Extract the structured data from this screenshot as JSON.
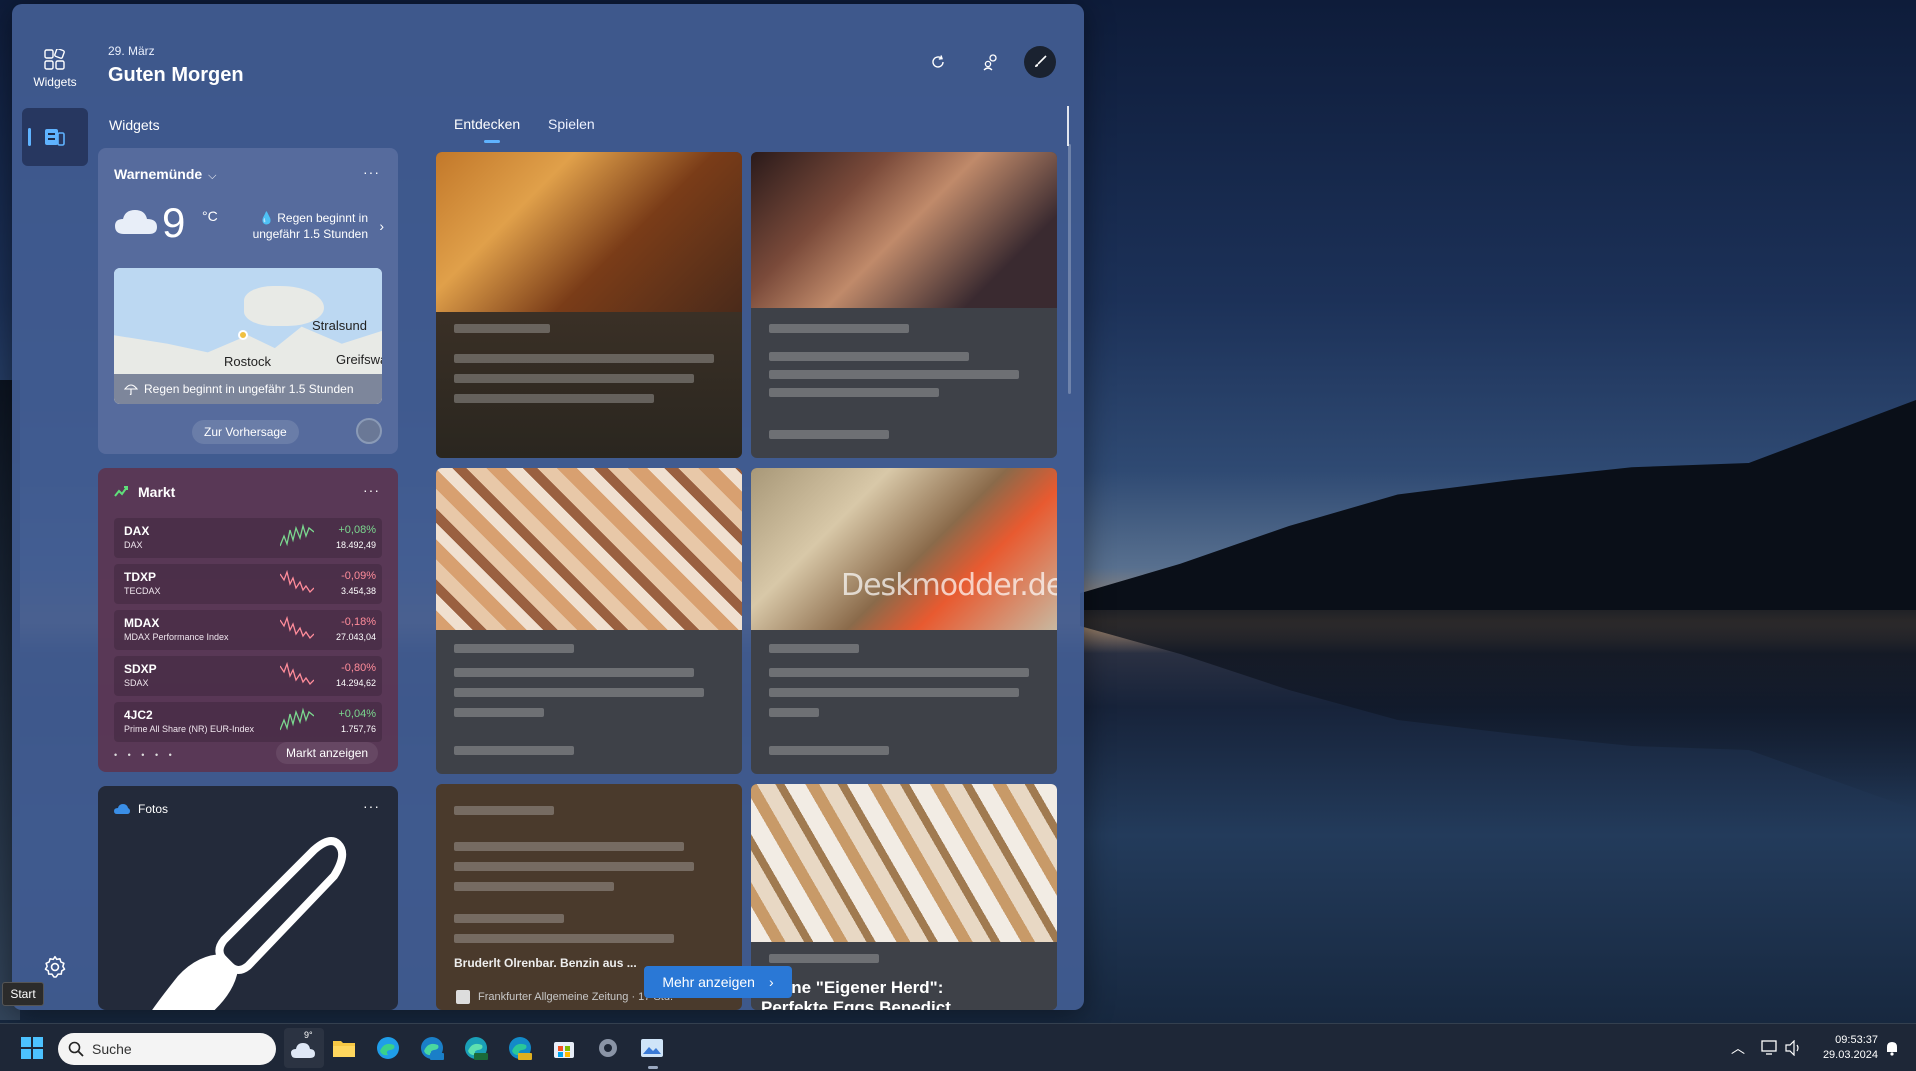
{
  "board": {
    "date": "29. März",
    "greeting": "Guten Morgen",
    "section_label": "Widgets",
    "tabs": [
      "Entdecken",
      "Spielen"
    ]
  },
  "rail": {
    "widgets_label": "Widgets"
  },
  "weather": {
    "location": "Warnemünde",
    "temperature": "9",
    "unit": "°C",
    "rain_notice": "Regen beginnt in ungefähr 1.5 Stunden",
    "map_cities": [
      "Stralsund",
      "Rostock",
      "Greifswa"
    ],
    "map_caption": "Regen beginnt in ungefähr 1.5 Stunden",
    "forecast_button": "Zur Vorhersage",
    "menu": "···"
  },
  "market": {
    "title": "Markt",
    "menu": "···",
    "rows": [
      {
        "symbol": "DAX",
        "name": "DAX",
        "change": "+0,08%",
        "price": "18.492,49",
        "trend": "up"
      },
      {
        "symbol": "TDXP",
        "name": "TECDAX",
        "change": "-0,09%",
        "price": "3.454,38",
        "trend": "down"
      },
      {
        "symbol": "MDAX",
        "name": "MDAX Performance Index",
        "change": "-0,18%",
        "price": "27.043,04",
        "trend": "down"
      },
      {
        "symbol": "SDXP",
        "name": "SDAX",
        "change": "-0,80%",
        "price": "14.294,62",
        "trend": "down"
      },
      {
        "symbol": "4JC2",
        "name": "Prime All Share (NR) EUR-Index",
        "change": "+0,04%",
        "price": "1.757,76",
        "trend": "up"
      }
    ],
    "show_button": "Markt anzeigen",
    "page_dots": "• • • • •"
  },
  "photos": {
    "title": "Fotos",
    "menu": "···"
  },
  "news": {
    "watermark": "Deskmodder.de",
    "card5_headline": "Bruderlt Olrenbar. Benzin aus ...",
    "card5_source": "Frankfurter Allgemeine Zeitung · 17 Std.",
    "card6_title_line1": "lumne \"Eigener Herd\":",
    "card6_title_line2": "Perfekte Eggs Benedict"
  },
  "more_button": "Mehr anzeigen",
  "start_tooltip": "Start",
  "taskbar": {
    "search_placeholder": "Suche",
    "weather_temp": "9°",
    "time": "09:53:37",
    "date": "29.03.2024"
  },
  "colors": {
    "accent": "#2a78d6",
    "positive": "#7bd88f",
    "negative": "#ff8c9a"
  }
}
